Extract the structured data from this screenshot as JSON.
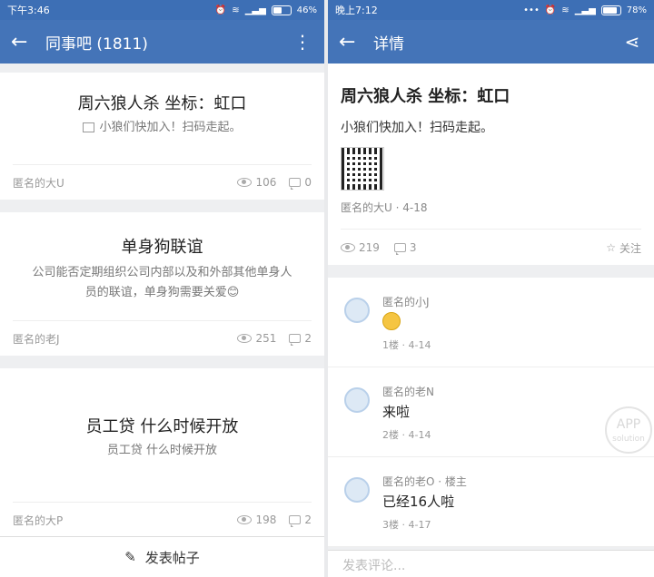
{
  "left": {
    "status": {
      "time": "下午3:46",
      "battery": "46%",
      "battery_level": 0.46
    },
    "appbar": {
      "title": "同事吧 (1811)"
    },
    "posts": [
      {
        "title": "周六狼人杀 坐标：虹口",
        "subtitle": "小狼们快加入！扫码走起。",
        "author": "匿名的大U",
        "views": "106",
        "comments": "0"
      },
      {
        "title": "单身狗联谊",
        "subtitle": "公司能否定期组织公司内部以及和外部其他单身人员的联谊，单身狗需要关爱😊",
        "author": "匿名的老J",
        "views": "251",
        "comments": "2"
      },
      {
        "title": "员工贷 什么时候开放",
        "subtitle": "员工贷 什么时候开放",
        "author": "匿名的大P",
        "views": "198",
        "comments": "2"
      }
    ],
    "bottom_action": "发表帖子"
  },
  "right": {
    "status": {
      "time": "晚上7:12",
      "battery": "78%",
      "battery_level": 0.78
    },
    "appbar": {
      "title": "详情"
    },
    "post": {
      "title": "周六狼人杀 坐标：虹口",
      "body": "小狼们快加入！扫码走起。",
      "author_date": "匿名的大U · 4-18",
      "views": "219",
      "comments": "3",
      "follow": "关注"
    },
    "comments": [
      {
        "name": "匿名的小J",
        "text": "",
        "info": "1楼 · 4-14"
      },
      {
        "name": "匿名的老N",
        "text": "来啦",
        "info": "2楼 · 4-14"
      },
      {
        "name": "匿名的老O · 楼主",
        "text": "已经16人啦",
        "info": "3楼 · 4-17"
      }
    ],
    "input_placeholder": "发表评论...",
    "watermark": {
      "line1": "APP",
      "line2": "solution"
    }
  }
}
